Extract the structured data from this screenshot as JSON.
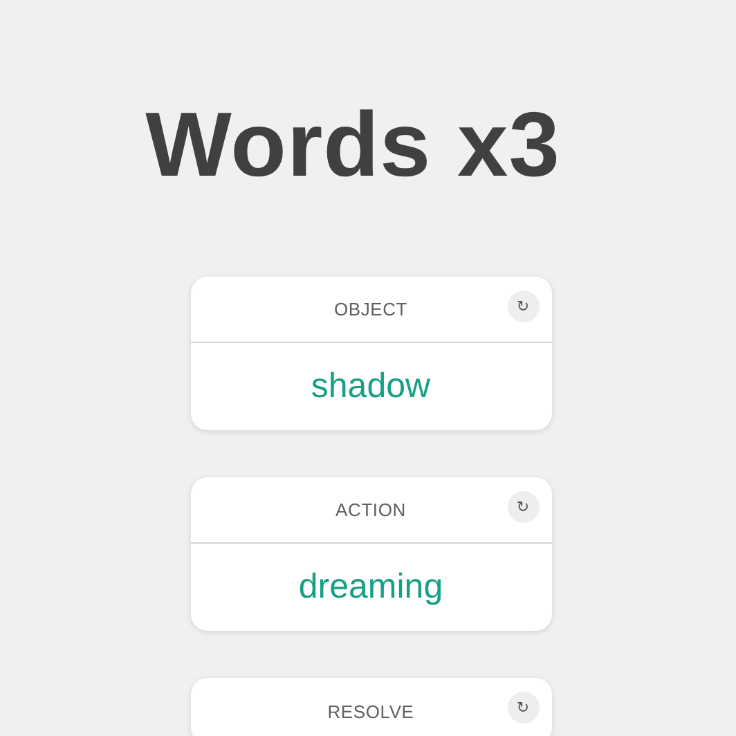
{
  "title": "Words x3",
  "cards": [
    {
      "label": "OBJECT",
      "refresh": "↻",
      "word": "shadow"
    },
    {
      "label": "ACTION",
      "refresh": "↻",
      "word": "dreaming"
    },
    {
      "label": "RESOLVE",
      "refresh": "↻"
    }
  ]
}
